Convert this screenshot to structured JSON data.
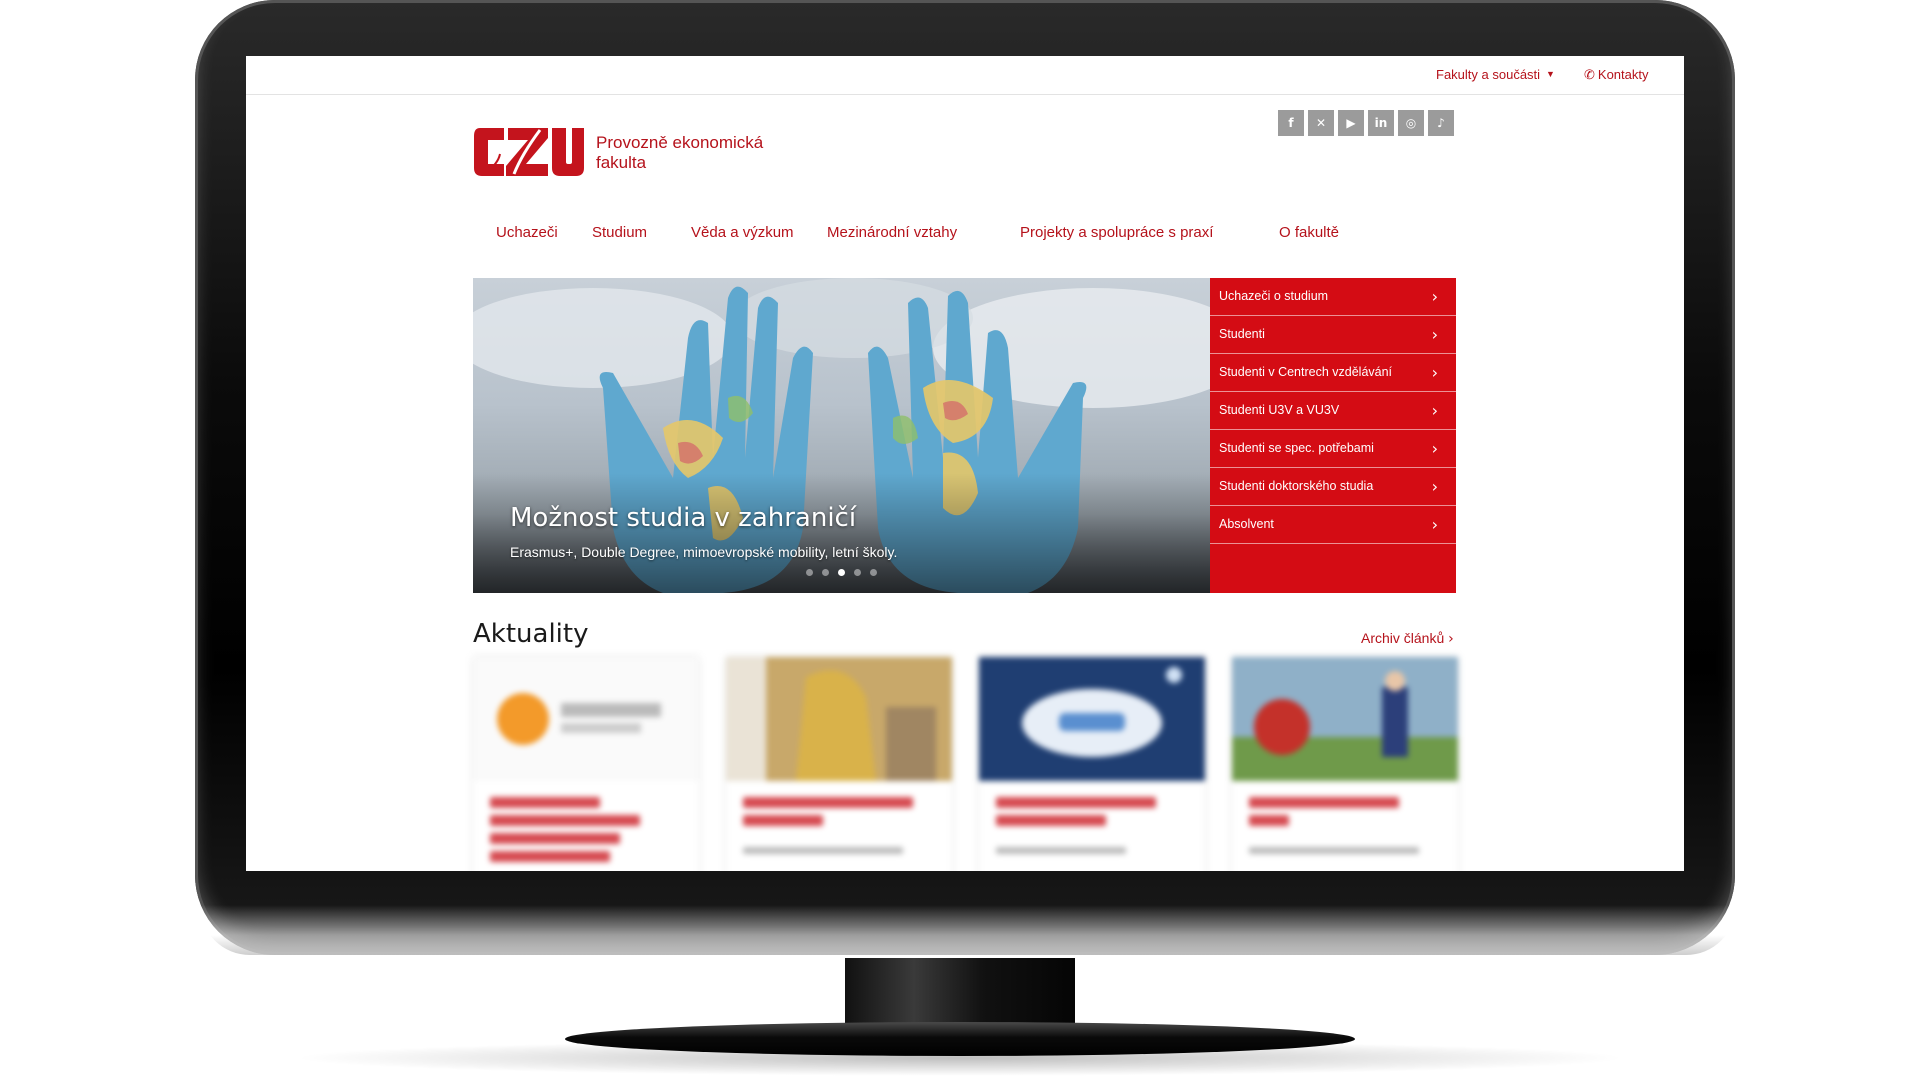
{
  "topbar": {
    "faculties_label": "Fakulty a součásti",
    "contacts_label": "Kontakty"
  },
  "header": {
    "logo_alt": "ČZU",
    "faculty_line1": "Provozně ekonomická",
    "faculty_line2": "fakulta",
    "socials": [
      "facebook-icon",
      "x-icon",
      "youtube-icon",
      "linkedin-icon",
      "instagram-icon",
      "tiktok-icon"
    ]
  },
  "nav": {
    "items": [
      {
        "label": "Uchazeči"
      },
      {
        "label": "Studium"
      },
      {
        "label": "Věda a výzkum"
      },
      {
        "label": "Mezinárodní vztahy"
      },
      {
        "label": "Projekty a spolupráce s praxí"
      },
      {
        "label": "O fakultě"
      }
    ]
  },
  "hero": {
    "title": "Možnost studia v zahraničí",
    "subtitle": "Erasmus+, Double Degree, mimoevropské mobility, letní školy.",
    "slides_count": 5,
    "active_slide": 3
  },
  "sidemenu": {
    "items": [
      {
        "label": "Uchazeči o studium"
      },
      {
        "label": "Studenti"
      },
      {
        "label": "Studenti v Centrech vzdělávání"
      },
      {
        "label": "Studenti U3V a VU3V"
      },
      {
        "label": "Studenti se spec. potřebami"
      },
      {
        "label": "Studenti doktorského studia"
      },
      {
        "label": "Absolvent"
      }
    ]
  },
  "news": {
    "heading": "Aktuality",
    "archive_label": "Archiv článků"
  },
  "colors": {
    "brand_red": "#b5121b",
    "menu_red": "#d40c14"
  }
}
